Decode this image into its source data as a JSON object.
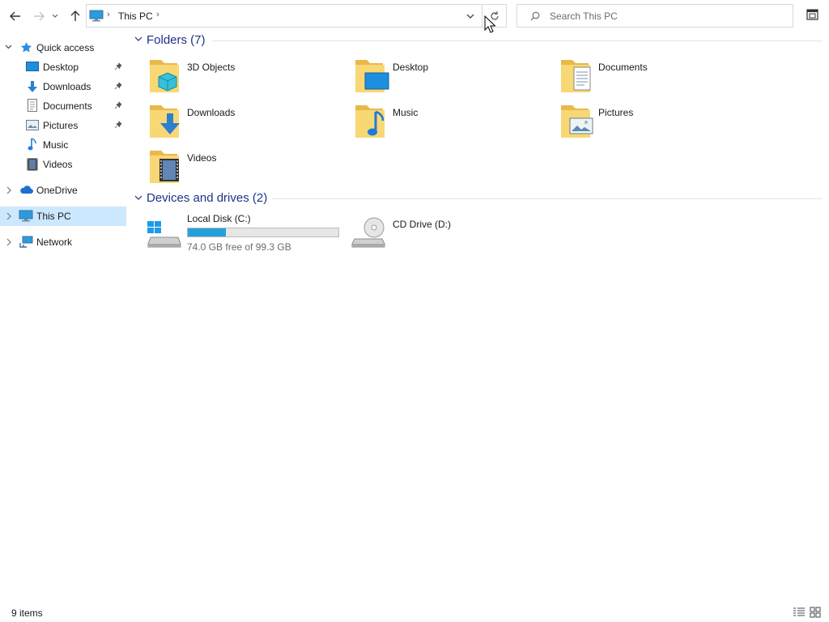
{
  "toolbar": {
    "address_location": "This PC",
    "search_placeholder": "Search This PC"
  },
  "sidebar": {
    "items": [
      {
        "label": "Quick access",
        "icon": "star-icon"
      },
      {
        "label": "Desktop",
        "icon": "desktop-icon",
        "pinned": true
      },
      {
        "label": "Downloads",
        "icon": "download-arrow-icon",
        "pinned": true
      },
      {
        "label": "Documents",
        "icon": "document-icon",
        "pinned": true
      },
      {
        "label": "Pictures",
        "icon": "picture-icon",
        "pinned": true
      },
      {
        "label": "Music",
        "icon": "music-note-icon"
      },
      {
        "label": "Videos",
        "icon": "film-icon"
      },
      {
        "label": "OneDrive",
        "icon": "cloud-icon"
      },
      {
        "label": "This PC",
        "icon": "computer-icon",
        "selected": true
      },
      {
        "label": "Network",
        "icon": "network-icon"
      }
    ]
  },
  "folders": {
    "header": "Folders (7)",
    "items": [
      {
        "label": "3D Objects",
        "icon": "3d-objects-folder-icon"
      },
      {
        "label": "Desktop",
        "icon": "desktop-folder-icon"
      },
      {
        "label": "Documents",
        "icon": "documents-folder-icon"
      },
      {
        "label": "Downloads",
        "icon": "downloads-folder-icon"
      },
      {
        "label": "Music",
        "icon": "music-folder-icon"
      },
      {
        "label": "Pictures",
        "icon": "pictures-folder-icon"
      },
      {
        "label": "Videos",
        "icon": "videos-folder-icon"
      }
    ]
  },
  "drives": {
    "header": "Devices and drives (2)",
    "items": [
      {
        "label": "Local Disk (C:)",
        "free_text": "74.0 GB free of 99.3 GB",
        "used_fraction": 0.255,
        "icon": "windows-drive-icon"
      },
      {
        "label": "CD Drive (D:)",
        "icon": "cd-drive-icon"
      }
    ]
  },
  "status": {
    "item_count": "9 items"
  },
  "colors": {
    "accent": "#26a0da",
    "selection": "#cce8ff",
    "header_text": "#1e3287",
    "folder": "#f8d775"
  }
}
